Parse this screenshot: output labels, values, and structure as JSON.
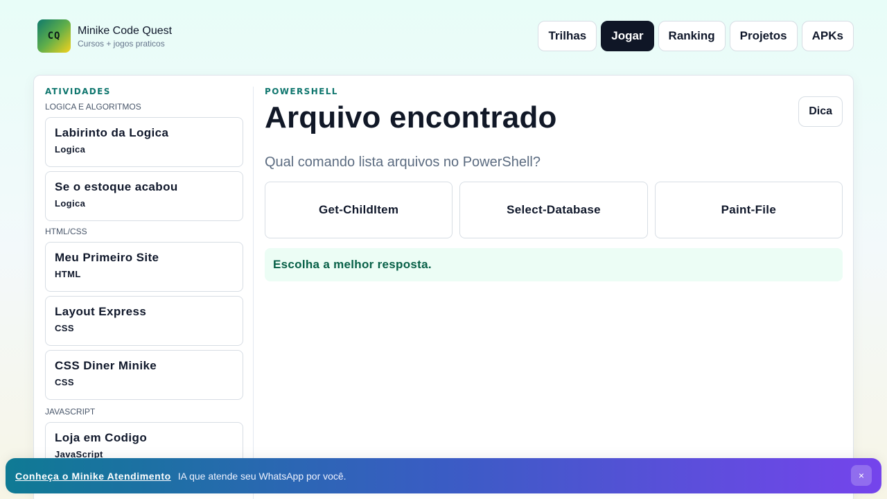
{
  "brand": {
    "logo_text": "CQ",
    "title": "Minike Code Quest",
    "subtitle": "Cursos + jogos praticos"
  },
  "nav": {
    "items": [
      {
        "label": "Trilhas",
        "active": false
      },
      {
        "label": "Jogar",
        "active": true
      },
      {
        "label": "Ranking",
        "active": false
      },
      {
        "label": "Projetos",
        "active": false
      },
      {
        "label": "APKs",
        "active": false
      }
    ]
  },
  "sidebar": {
    "heading": "ATIVIDADES",
    "groups": [
      {
        "label": "LOGICA E ALGORITMOS",
        "items": [
          {
            "title": "Labirinto da Logica",
            "tag": "Logica"
          },
          {
            "title": "Se o estoque acabou",
            "tag": "Logica"
          }
        ]
      },
      {
        "label": "HTML/CSS",
        "items": [
          {
            "title": "Meu Primeiro Site",
            "tag": "HTML"
          },
          {
            "title": "Layout Express",
            "tag": "CSS"
          },
          {
            "title": "CSS Diner Minike",
            "tag": "CSS"
          }
        ]
      },
      {
        "label": "JAVASCRIPT",
        "items": [
          {
            "title": "Loja em Codigo",
            "tag": "JavaScript"
          }
        ]
      }
    ]
  },
  "activity": {
    "category": "POWERSHELL",
    "title": "Arquivo encontrado",
    "hint_label": "Dica",
    "question": "Qual comando lista arquivos no PowerShell?",
    "options": [
      "Get-ChildItem",
      "Select-Database",
      "Paint-File"
    ],
    "feedback": "Escolha a melhor resposta."
  },
  "banner": {
    "link_text": "Conheça o Minike Atendimento",
    "text": "IA que atende seu WhatsApp por você.",
    "close_label": "×"
  }
}
